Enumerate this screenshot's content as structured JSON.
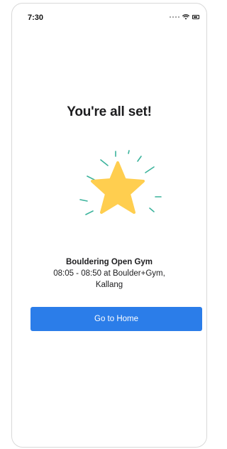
{
  "status_bar": {
    "time": "7:30",
    "icons": [
      "signal-dots-icon",
      "wifi-icon",
      "battery-icon"
    ]
  },
  "confirmation": {
    "title": "You're all set!",
    "icon": "star-icon",
    "event_name": "Bouldering Open Gym",
    "event_time_location": "08:05 - 08:50 at Boulder+Gym,",
    "event_location_cont": "Kallang"
  },
  "actions": {
    "home_button_label": "Go to Home"
  },
  "colors": {
    "star": "#ffce4f",
    "sparkle": "#3bb39c",
    "button": "#2b7de9",
    "title_text": "#1d1d1f"
  }
}
